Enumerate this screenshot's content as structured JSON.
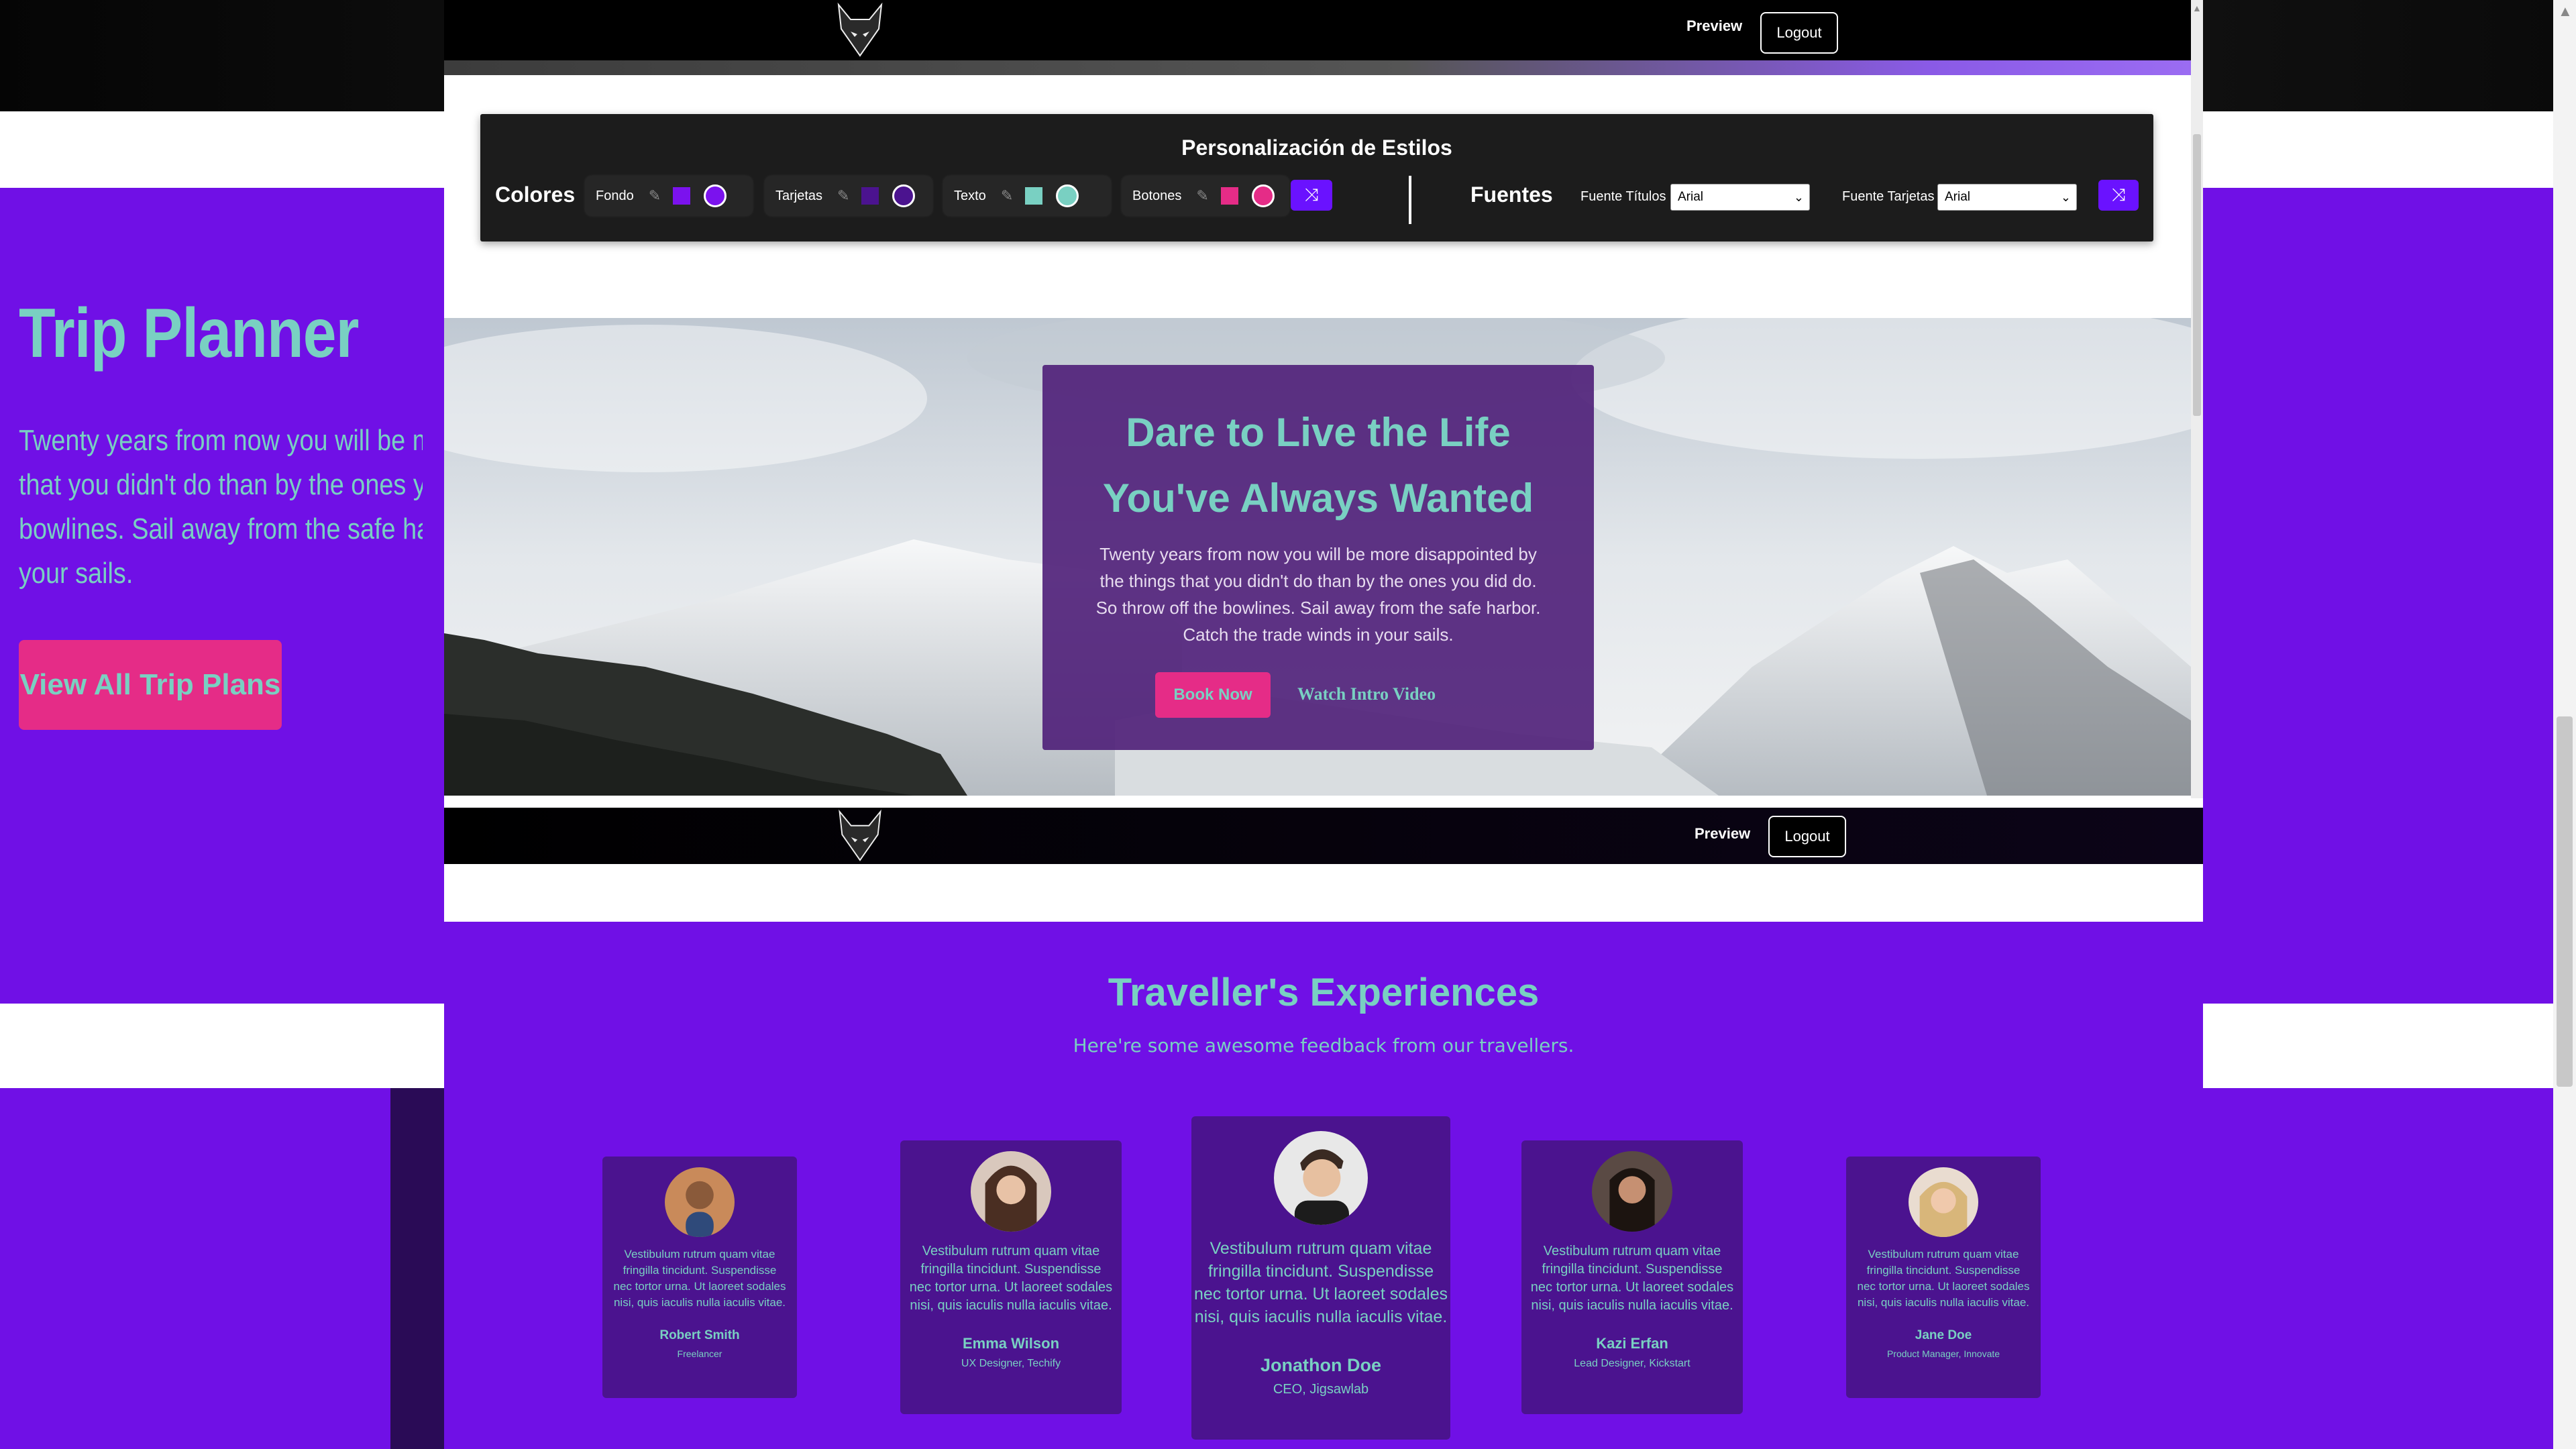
{
  "background": {
    "title": "Trip Planner",
    "paragraph_lines": [
      "Twenty years from now you will be more disappointed by",
      "that you didn't do than by the ones you did do. So throw off the",
      "bowlines. Sail away from the safe harbor. Catch the trade winds in",
      "your sails."
    ],
    "button": "View All Trip Plans"
  },
  "nav": {
    "preview": "Preview",
    "logout": "Logout"
  },
  "panel": {
    "title": "Personalización de Estilos",
    "colors_heading": "Colores",
    "fonts_heading": "Fuentes",
    "color_groups": [
      {
        "label": "Fondo",
        "square": "#7b12ee",
        "circle": "#7b12ee"
      },
      {
        "label": "Tarjetas",
        "square": "#4b138f",
        "circle": "#4b138f"
      },
      {
        "label": "Texto",
        "square": "#79d0c2",
        "circle": "#79d0c2"
      },
      {
        "label": "Botones",
        "square": "#e52c87",
        "circle": "#e52c87"
      }
    ],
    "font_titles_label": "Fuente Títulos",
    "font_titles_value": "Arial",
    "font_cards_label": "Fuente Tarjetas",
    "font_cards_value": "Arial",
    "shuffle_icon": "shuffle-icon"
  },
  "hero": {
    "heading_line1": "Dare to Live the Life",
    "heading_line2": "You've Always Wanted",
    "paragraph_lines": [
      "Twenty years from now you will be more disappointed by",
      "the things that you didn't do than by the ones you did do.",
      "So throw off the bowlines. Sail away from the safe harbor.",
      "Catch the trade winds in your sails."
    ],
    "book_button": "Book Now",
    "watch_button": "Watch Intro Video"
  },
  "testimonials": {
    "heading": "Traveller's Experiences",
    "subheading": "Here're some awesome feedback from our travellers.",
    "quote_lines": [
      "Vestibulum rutrum quam vitae",
      "fringilla tincidunt. Suspendisse",
      "nec tortor urna. Ut laoreet sodales",
      "nisi, quis iaculis nulla iaculis vitae."
    ],
    "people": [
      {
        "name": "Robert Smith",
        "role": "Freelancer"
      },
      {
        "name": "Emma Wilson",
        "role": "UX Designer, Techify"
      },
      {
        "name": "Jonathon Doe",
        "role": "CEO, Jigsawlab"
      },
      {
        "name": "Kazi Erfan",
        "role": "Lead Designer, Kickstart"
      },
      {
        "name": "Jane Doe",
        "role": "Product Manager, Innovate"
      }
    ]
  },
  "colors": {
    "purple": "#7010e6",
    "card": "#4b138f",
    "teal": "#79d0c2",
    "pink": "#e52c87"
  }
}
